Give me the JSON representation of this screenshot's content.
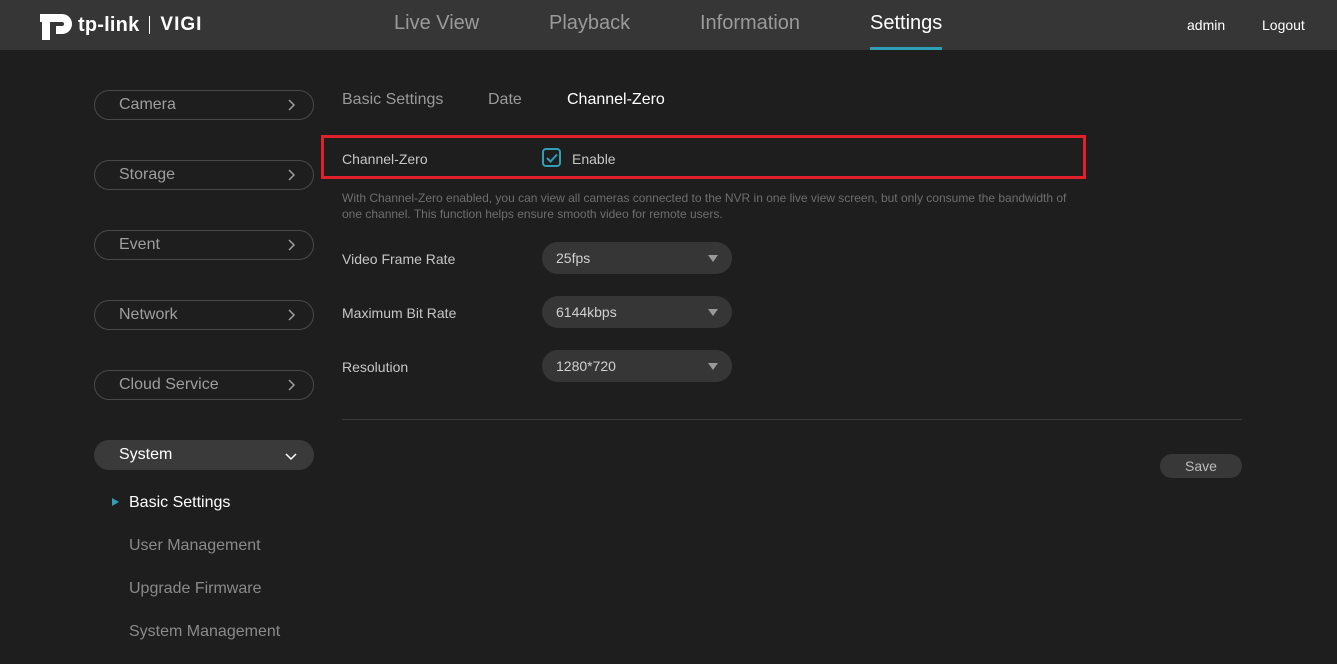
{
  "header": {
    "logo_text": "tp-link",
    "logo_product": "VIGI",
    "nav": [
      {
        "label": "Live View"
      },
      {
        "label": "Playback"
      },
      {
        "label": "Information"
      },
      {
        "label": "Settings"
      }
    ],
    "active_nav": "Settings",
    "user": "admin",
    "logout_label": "Logout"
  },
  "sidebar": {
    "groups": [
      {
        "label": "Camera"
      },
      {
        "label": "Storage"
      },
      {
        "label": "Event"
      },
      {
        "label": "Network"
      },
      {
        "label": "Cloud Service"
      },
      {
        "label": "System"
      }
    ],
    "expanded_group": "System",
    "sub_items": [
      {
        "label": "Basic Settings"
      },
      {
        "label": "User Management"
      },
      {
        "label": "Upgrade Firmware"
      },
      {
        "label": "System Management"
      }
    ],
    "active_sub_item": "Basic Settings"
  },
  "main": {
    "tabs": [
      {
        "label": "Basic Settings"
      },
      {
        "label": "Date"
      },
      {
        "label": "Channel-Zero"
      }
    ],
    "active_tab": "Channel-Zero",
    "channel_zero": {
      "label": "Channel-Zero",
      "checkbox_label": "Enable",
      "checked": true
    },
    "description": "With Channel-Zero enabled, you can view all cameras connected to the NVR in one live view screen, but only consume the bandwidth of one channel. This function helps ensure smooth video for remote users.",
    "fields": [
      {
        "label": "Video Frame Rate",
        "value": "25fps"
      },
      {
        "label": "Maximum Bit Rate",
        "value": "6144kbps"
      },
      {
        "label": "Resolution",
        "value": "1280*720"
      }
    ],
    "save_label": "Save"
  },
  "colors": {
    "accent": "#2f9fb6",
    "highlight": "#e0202a",
    "background": "#1e1e1e",
    "topbar": "#363636"
  }
}
